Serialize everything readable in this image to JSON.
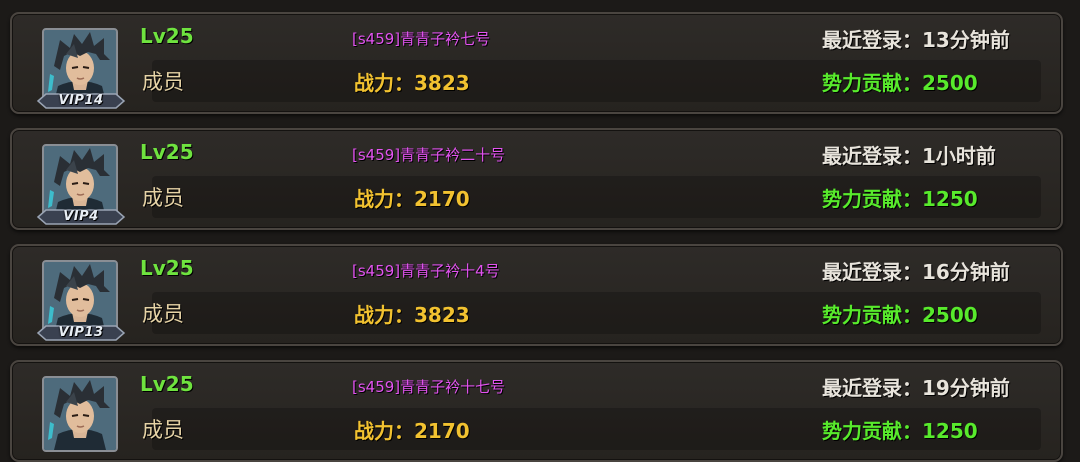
{
  "members": [
    {
      "level": "Lv25",
      "role": "成员",
      "name": "[s459]青青子衿七号",
      "power_label": "战力：",
      "power": "3823",
      "login_label": "最近登录：",
      "login": "13分钟前",
      "contrib_label": "势力贡献：",
      "contrib": "2500",
      "vip": "VIP14",
      "avatar_icon": "hero-portrait-icon"
    },
    {
      "level": "Lv25",
      "role": "成员",
      "name": "[s459]青青子衿二十号",
      "power_label": "战力：",
      "power": "2170",
      "login_label": "最近登录：",
      "login": "1小时前",
      "contrib_label": "势力贡献：",
      "contrib": "1250",
      "vip": "VIP4",
      "avatar_icon": "hero-portrait-icon"
    },
    {
      "level": "Lv25",
      "role": "成员",
      "name": "[s459]青青子衿十4号",
      "power_label": "战力：",
      "power": "3823",
      "login_label": "最近登录：",
      "login": "16分钟前",
      "contrib_label": "势力贡献：",
      "contrib": "2500",
      "vip": "VIP13",
      "avatar_icon": "hero-portrait-icon"
    },
    {
      "level": "Lv25",
      "role": "成员",
      "name": "[s459]青青子衿十七号",
      "power_label": "战力：",
      "power": "2170",
      "login_label": "最近登录：",
      "login": "19分钟前",
      "contrib_label": "势力贡献：",
      "contrib": "1250",
      "vip": "",
      "avatar_icon": "hero-portrait-icon"
    }
  ],
  "colors": {
    "level": "#6fe33f",
    "role": "#e6d3a6",
    "name": "#e253f0",
    "power": "#f2c230",
    "login": "#e8e4dc",
    "contrib": "#58ea2c"
  }
}
